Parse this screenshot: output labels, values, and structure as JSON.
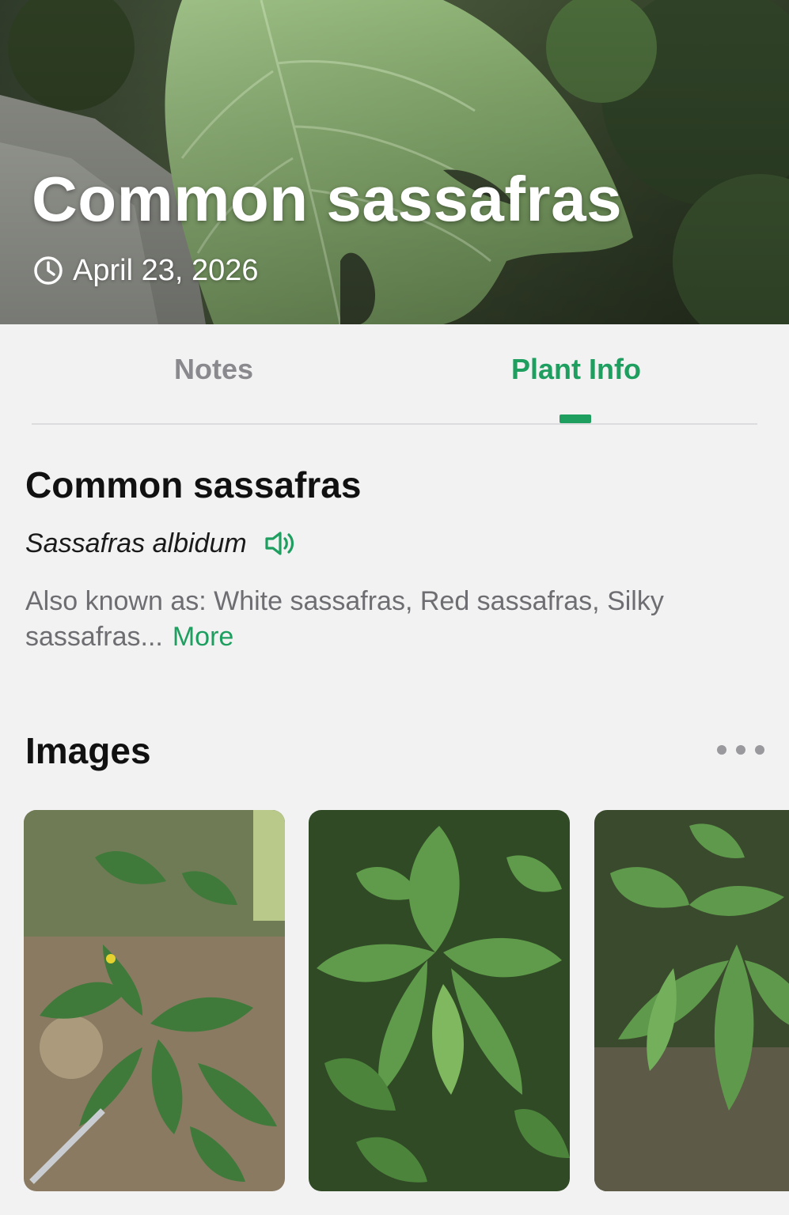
{
  "hero": {
    "title": "Common sassafras",
    "date": "April 23, 2026",
    "date_icon": "clock-icon"
  },
  "tabs": [
    {
      "label": "Notes",
      "active": false
    },
    {
      "label": "Plant Info",
      "active": true
    }
  ],
  "plant": {
    "common_name": "Common sassafras",
    "scientific_name": "Sassafras albidum",
    "pronounce_icon": "speaker-icon",
    "aka": "Also known as: White sassafras, Red sassafras, Silky sassafras...",
    "more_label": "More"
  },
  "images": {
    "title": "Images",
    "menu_icon": "more-dots-icon",
    "thumbnails": [
      "sassafras-photo-1",
      "sassafras-photo-2",
      "sassafras-photo-3"
    ]
  },
  "colors": {
    "accent": "#1e9e5f",
    "inactive_tab": "#8a8a8e",
    "background": "#f2f2f3",
    "body_text": "#6e6e72"
  }
}
